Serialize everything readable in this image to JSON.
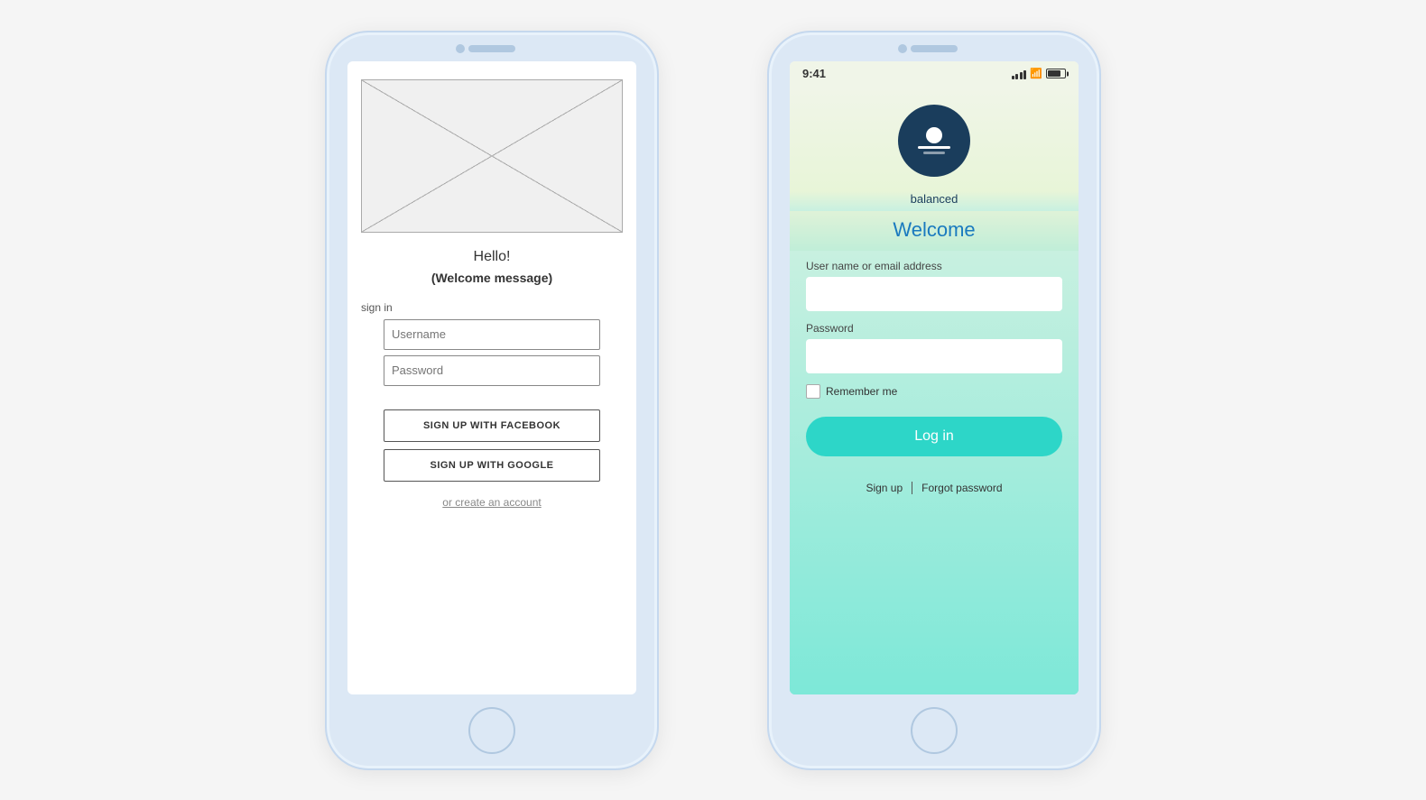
{
  "wireframe": {
    "hello": "Hello!",
    "welcome_message": "(Welcome message)",
    "signin_label": "sign in",
    "username_placeholder": "Username",
    "password_placeholder": "Password",
    "facebook_btn": "SIGN UP WITH FACEBOOK",
    "google_btn": "SIGN UP WITH GOOGLE",
    "create_account": "or create an account"
  },
  "balanced": {
    "status_time": "9:41",
    "app_name": "balanced",
    "welcome_text": "Welcome",
    "username_label": "User name or email address",
    "password_label": "Password",
    "remember_label": "Remember me",
    "login_btn": "Log in",
    "signup_link": "Sign up",
    "forgot_link": "Forgot password"
  }
}
